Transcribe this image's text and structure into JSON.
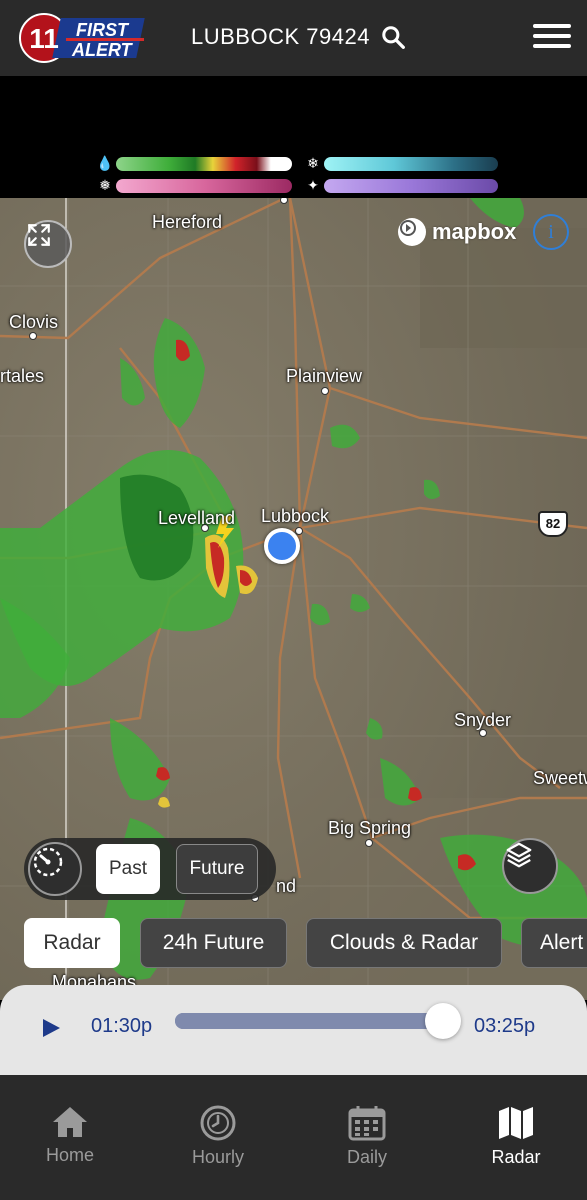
{
  "header": {
    "logo_text_top": "FIRST",
    "logo_text_bottom": "ALERT",
    "logo_number": "11",
    "location": "LUBBOCK 79424"
  },
  "map": {
    "attribution": "mapbox",
    "cities": [
      {
        "name": "Hereford"
      },
      {
        "name": "Clovis"
      },
      {
        "name": "rtales"
      },
      {
        "name": "Plainview"
      },
      {
        "name": "Levelland"
      },
      {
        "name": "Lubbock"
      },
      {
        "name": "Snyder"
      },
      {
        "name": "Sweetw"
      },
      {
        "name": "Big Spring"
      },
      {
        "name": "nd"
      },
      {
        "name": "Monahans"
      }
    ],
    "highway": "82"
  },
  "time_toggle": {
    "past_label": "Past",
    "future_label": "Future",
    "selected": "Past"
  },
  "chips": [
    {
      "label": "Radar",
      "active": true
    },
    {
      "label": "24h Future",
      "active": false
    },
    {
      "label": "Clouds & Radar",
      "active": false
    },
    {
      "label": "Alert",
      "active": false
    }
  ],
  "playback": {
    "start_time": "01:30p",
    "end_time": "03:25p",
    "progress": 1.0
  },
  "nav": [
    {
      "label": "Home",
      "icon": "home-icon",
      "active": false
    },
    {
      "label": "Hourly",
      "icon": "clock-icon",
      "active": false
    },
    {
      "label": "Daily",
      "icon": "calendar-icon",
      "active": false
    },
    {
      "label": "Radar",
      "icon": "map-icon",
      "active": true
    }
  ],
  "colors": {
    "header_bg": "#2a2a2a",
    "accent_blue": "#3b82f0",
    "time_text": "#1e3a8a",
    "radar_green": "#3fae3a"
  }
}
